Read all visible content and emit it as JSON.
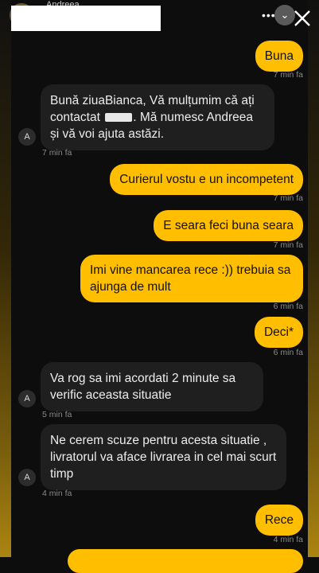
{
  "header": {
    "contact_name": "Andreea",
    "menu_icon": "more-dots-icon",
    "minimize_icon": "chevron-down-icon",
    "close_icon": "close-icon"
  },
  "messages": [
    {
      "dir": "out",
      "text": "Buna",
      "time": "7 min fa"
    },
    {
      "dir": "in",
      "avatar": "A",
      "text_before": "Bună ziuaBianca, Vă mulțumim că ați contactat ",
      "text_after": ". Mă numesc Andreea și vă voi ajuta astăzi.",
      "time": "7 min fa"
    },
    {
      "dir": "out",
      "text": "Curierul vostu e un incompetent",
      "time": "7 min fa"
    },
    {
      "dir": "out",
      "text": "E seara feci buna seara",
      "time": "7 min fa"
    },
    {
      "dir": "out",
      "text": "Imi vine mancarea rece :)) trebuia sa ajunga de mult",
      "time": "6 min fa"
    },
    {
      "dir": "out",
      "text": "Deci*",
      "time": "6 min fa"
    },
    {
      "dir": "in",
      "avatar": "A",
      "text": "Va rog sa imi acordati 2 minute sa verific aceasta situatie",
      "time": "5 min fa"
    },
    {
      "dir": "in",
      "avatar": "A",
      "text": "Ne cerem scuze pentru acesta situatie , livratorul va aface livrarea in cel mai scurt timp",
      "time": "4 min fa"
    },
    {
      "dir": "out",
      "text": "Rece",
      "time": "4 min fa"
    }
  ],
  "colors": {
    "outgoing": "#ffbf00",
    "incoming": "#1f1f1f",
    "background": "#0d0d0d"
  }
}
